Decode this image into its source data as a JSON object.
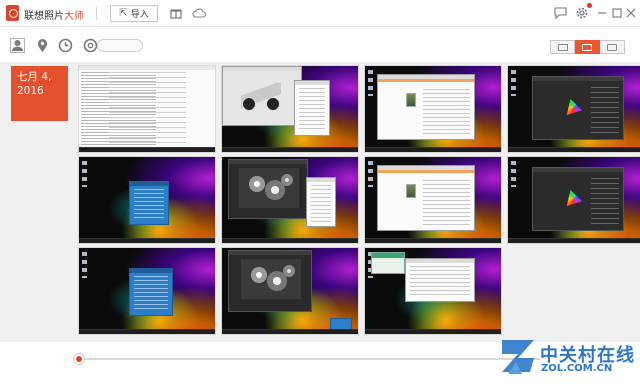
{
  "app": {
    "title_main": "联想照片",
    "title_accent": "大师",
    "import_label": "导入",
    "colors": {
      "accent": "#e3502d",
      "watermark": "#2a78c7"
    }
  },
  "titlebar_icons": [
    "gift-icon",
    "cloud-icon",
    "chat-icon",
    "gear-icon",
    "minimize-icon",
    "maximize-icon",
    "close-icon"
  ],
  "filters": {
    "icons": [
      "person-filter-icon",
      "location-filter-icon",
      "time-filter-icon",
      "search-icon"
    ],
    "search_placeholder": ""
  },
  "view_modes": [
    "detail-view-icon",
    "photo-view-icon",
    "folder-view-icon"
  ],
  "active_view": "photo-view-icon",
  "date_group": {
    "label": "七月 4,\n2016"
  },
  "thumbnails": [
    {
      "kind": "spreadsheet"
    },
    {
      "kind": "3d-render-bike"
    },
    {
      "kind": "image-viewer-orange"
    },
    {
      "kind": "color-gamut-dark"
    },
    {
      "kind": "blue-dialog"
    },
    {
      "kind": "benchmark-orbs"
    },
    {
      "kind": "image-viewer-orange"
    },
    {
      "kind": "color-gamut-dark"
    },
    {
      "kind": "blue-dialog"
    },
    {
      "kind": "benchmark-orbs-blue"
    },
    {
      "kind": "gpu-z-dialog"
    }
  ],
  "timeline": {
    "position": 0
  },
  "watermark": {
    "cn": "中关村在线",
    "en": "ZOL.COM.CN"
  }
}
